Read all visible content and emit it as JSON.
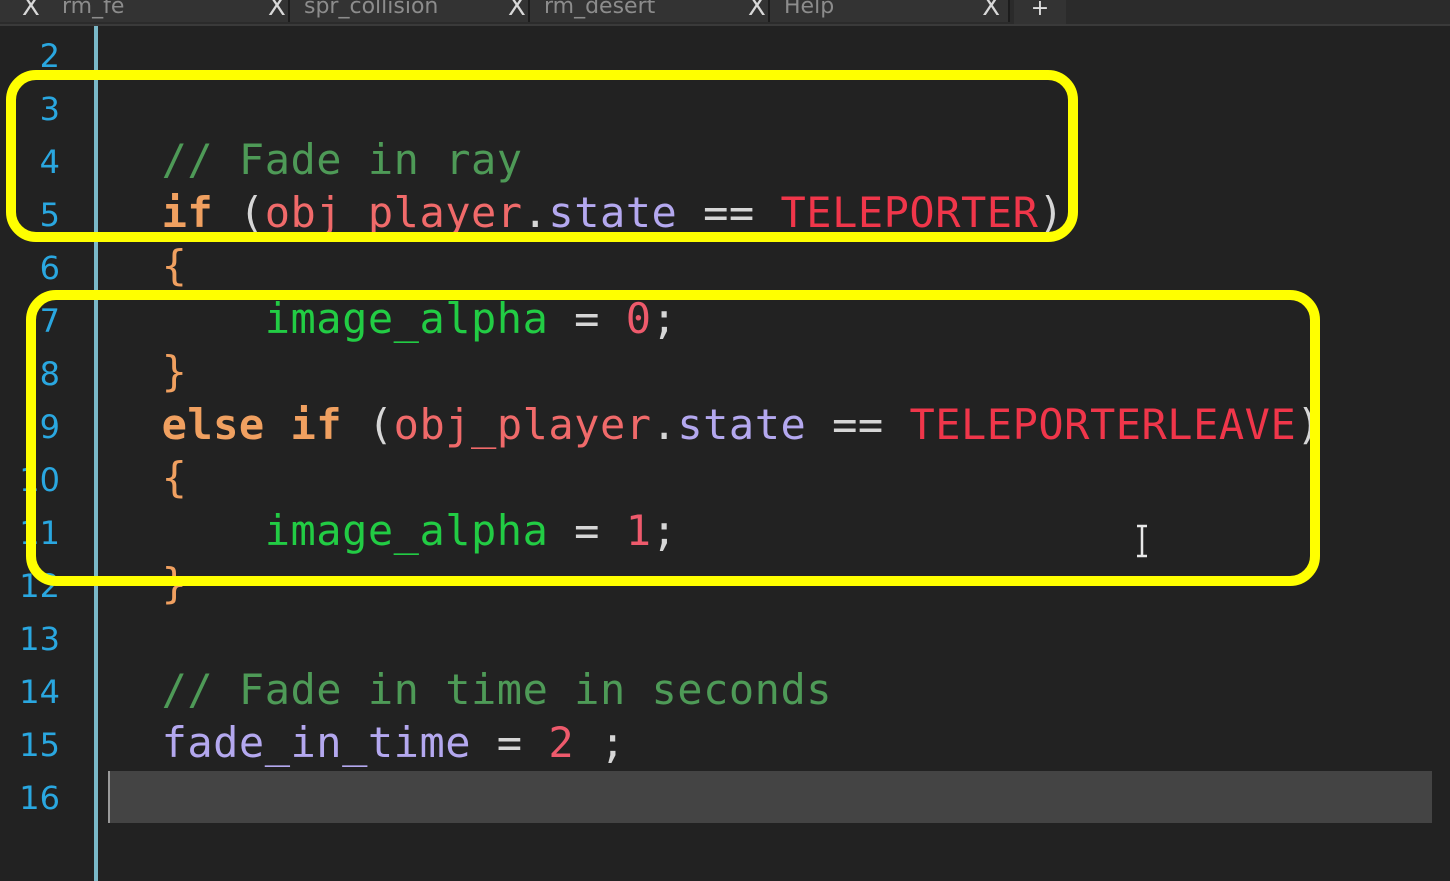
{
  "tabs": [
    {
      "label": "rm_fe",
      "close": "X"
    },
    {
      "label": "spr_collision",
      "close": "X"
    },
    {
      "label": "rm_desert",
      "close": "X"
    },
    {
      "label": "Help",
      "close": "X"
    }
  ],
  "new_tab_label": "+",
  "line_numbers": [
    "2",
    "3",
    "4",
    "5",
    "6",
    "7",
    "8",
    "9",
    "10",
    "11",
    "12",
    "13",
    "14",
    "15",
    "16"
  ],
  "code": {
    "l3_comment": "// Fade in ray",
    "l4_if": "if",
    "l4_paren_open": " (",
    "l4_obj": "obj_player",
    "l4_dot": ".",
    "l4_state": "state",
    "l4_eq": " == ",
    "l4_const": "TELEPORTER",
    "l4_paren_close": ")",
    "l5_brace": "{",
    "l6_indent": "    ",
    "l6_var": "image_alpha",
    "l6_assign": " = ",
    "l6_num": "0",
    "l6_semi": ";",
    "l7_brace": "}",
    "l8_else": "else",
    "l8_if": " if",
    "l8_paren_open": " (",
    "l8_obj": "obj_player",
    "l8_dot": ".",
    "l8_state": "state",
    "l8_eq": " == ",
    "l8_const": "TELEPORTERLEAVE",
    "l8_paren_close": ")",
    "l9_brace": "{",
    "l10_indent": "    ",
    "l10_var": "image_alpha",
    "l10_assign": " = ",
    "l10_num": "1",
    "l10_semi": ";",
    "l11_brace": "}",
    "l13_comment": "// Fade in time in seconds",
    "l14_var": "fade_in_time",
    "l14_assign": " = ",
    "l14_num": "2",
    "l14_semi": " ;"
  },
  "colors": {
    "background": "#222222",
    "gutter_numbers": "#2aa7e0",
    "highlight_boxes": "#ffff00",
    "comment": "#4e9a57",
    "keyword": "#f0a060",
    "constant": "#f0364a",
    "builtin": "#22cc44"
  },
  "icons": [
    "close-icon",
    "plus-icon",
    "text-cursor-icon"
  ]
}
